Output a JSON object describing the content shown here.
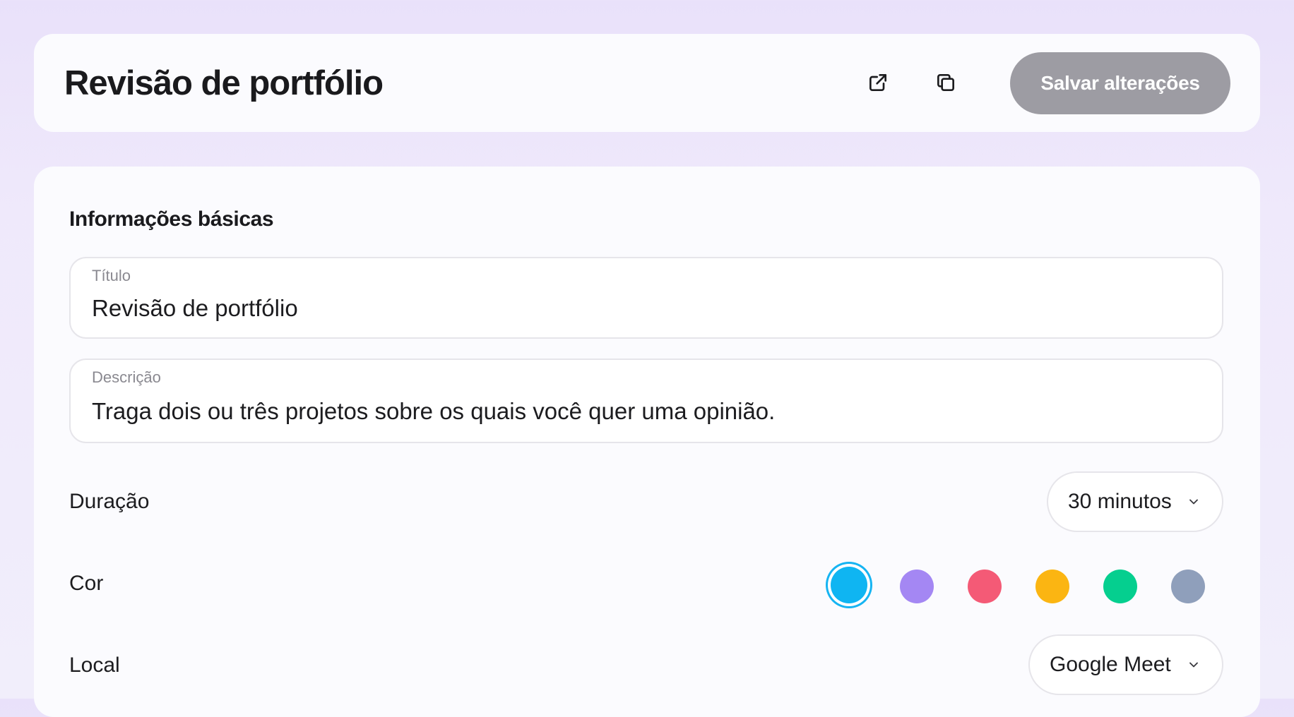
{
  "header": {
    "title": "Revisão de portfólio",
    "open_icon": "external-link-icon",
    "copy_icon": "copy-icon",
    "save_label": "Salvar alterações"
  },
  "basic_info": {
    "section_title": "Informações básicas",
    "title_field": {
      "label": "Título",
      "value": "Revisão de portfólio"
    },
    "description_field": {
      "label": "Descrição",
      "value": "Traga dois ou três projetos sobre os quais você quer uma opinião."
    },
    "duration": {
      "label": "Duração",
      "value": "30 minutos"
    },
    "color": {
      "label": "Cor",
      "options": [
        "#0fb5f2",
        "#a487f3",
        "#f45a76",
        "#fbb512",
        "#05cf8f",
        "#8f9fbb"
      ],
      "selected_index": 0
    },
    "location": {
      "label": "Local",
      "value": "Google Meet"
    }
  }
}
